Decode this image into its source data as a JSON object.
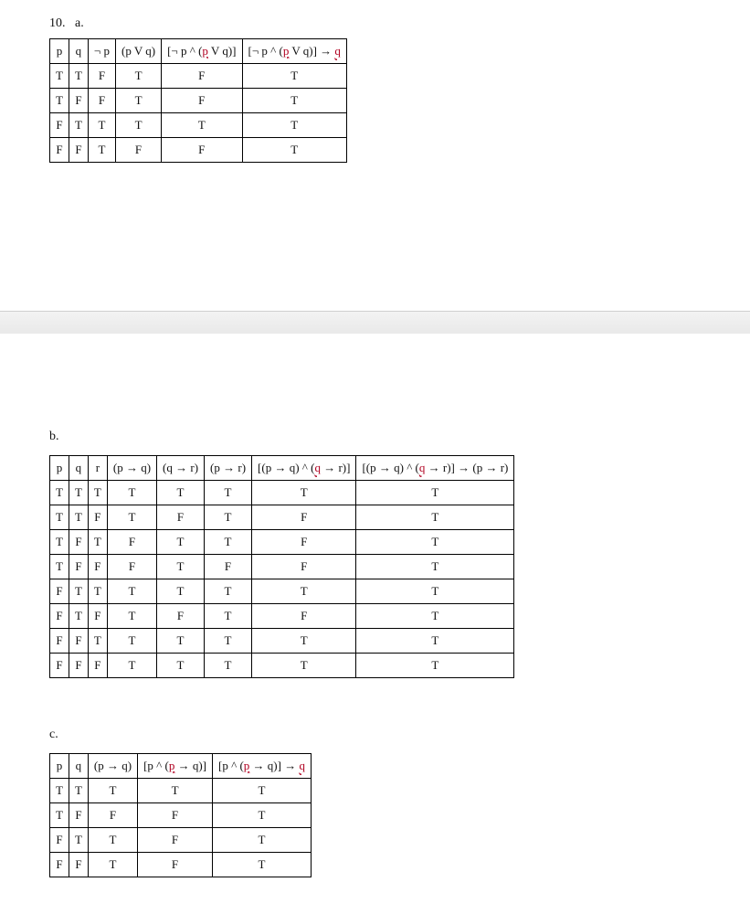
{
  "problem_number": "10.",
  "parts": {
    "a": {
      "label": "a.",
      "headers": [
        "p",
        "q",
        "¬ p",
        "(p V q)",
        "[¬ p ^ (p V q)]",
        "[¬ p ^ (p V q)] → q"
      ],
      "rows": [
        [
          "T",
          "T",
          "F",
          "T",
          "F",
          "T"
        ],
        [
          "T",
          "F",
          "F",
          "T",
          "F",
          "T"
        ],
        [
          "F",
          "T",
          "T",
          "T",
          "T",
          "T"
        ],
        [
          "F",
          "F",
          "T",
          "F",
          "F",
          "T"
        ]
      ]
    },
    "b": {
      "label": "b.",
      "headers": [
        "p",
        "q",
        "r",
        "(p → q)",
        "(q → r)",
        "(p → r)",
        "[(p → q) ^ (q → r)]",
        "[(p → q) ^ (q → r)] → (p → r)"
      ],
      "rows": [
        [
          "T",
          "T",
          "T",
          "T",
          "T",
          "T",
          "T",
          "T"
        ],
        [
          "T",
          "T",
          "F",
          "T",
          "F",
          "T",
          "F",
          "T"
        ],
        [
          "T",
          "F",
          "T",
          "F",
          "T",
          "T",
          "F",
          "T"
        ],
        [
          "T",
          "F",
          "F",
          "F",
          "T",
          "F",
          "F",
          "T"
        ],
        [
          "F",
          "T",
          "T",
          "T",
          "T",
          "T",
          "T",
          "T"
        ],
        [
          "F",
          "T",
          "F",
          "T",
          "F",
          "T",
          "F",
          "T"
        ],
        [
          "F",
          "F",
          "T",
          "T",
          "T",
          "T",
          "T",
          "T"
        ],
        [
          "F",
          "F",
          "F",
          "T",
          "T",
          "T",
          "T",
          "T"
        ]
      ]
    },
    "c": {
      "label": "c.",
      "headers": [
        "p",
        "q",
        "(p → q)",
        "[p ^ (p → q)]",
        "[p ^ (p → q)] → q"
      ],
      "rows": [
        [
          "T",
          "T",
          "T",
          "T",
          "T"
        ],
        [
          "T",
          "F",
          "F",
          "F",
          "T"
        ],
        [
          "F",
          "T",
          "T",
          "F",
          "T"
        ],
        [
          "F",
          "F",
          "T",
          "F",
          "T"
        ]
      ]
    }
  },
  "chart_data": [
    {
      "type": "table",
      "title": "10.a truth table",
      "columns": [
        "p",
        "q",
        "¬p",
        "(p ∨ q)",
        "¬p ∧ (p ∨ q)",
        "[¬p ∧ (p ∨ q)] → q"
      ],
      "rows": [
        [
          "T",
          "T",
          "F",
          "T",
          "F",
          "T"
        ],
        [
          "T",
          "F",
          "F",
          "T",
          "F",
          "T"
        ],
        [
          "F",
          "T",
          "T",
          "T",
          "T",
          "T"
        ],
        [
          "F",
          "F",
          "T",
          "F",
          "F",
          "T"
        ]
      ]
    },
    {
      "type": "table",
      "title": "10.b truth table",
      "columns": [
        "p",
        "q",
        "r",
        "(p→q)",
        "(q→r)",
        "(p→r)",
        "(p→q)∧(q→r)",
        "[(p→q)∧(q→r)]→(p→r)"
      ],
      "rows": [
        [
          "T",
          "T",
          "T",
          "T",
          "T",
          "T",
          "T",
          "T"
        ],
        [
          "T",
          "T",
          "F",
          "T",
          "F",
          "T",
          "F",
          "T"
        ],
        [
          "T",
          "F",
          "T",
          "F",
          "T",
          "T",
          "F",
          "T"
        ],
        [
          "T",
          "F",
          "F",
          "F",
          "T",
          "F",
          "F",
          "T"
        ],
        [
          "F",
          "T",
          "T",
          "T",
          "T",
          "T",
          "T",
          "T"
        ],
        [
          "F",
          "T",
          "F",
          "T",
          "F",
          "T",
          "F",
          "T"
        ],
        [
          "F",
          "F",
          "T",
          "T",
          "T",
          "T",
          "T",
          "T"
        ],
        [
          "F",
          "F",
          "F",
          "T",
          "T",
          "T",
          "T",
          "T"
        ]
      ]
    },
    {
      "type": "table",
      "title": "10.c truth table",
      "columns": [
        "p",
        "q",
        "(p→q)",
        "p∧(p→q)",
        "[p∧(p→q)]→q"
      ],
      "rows": [
        [
          "T",
          "T",
          "T",
          "T",
          "T"
        ],
        [
          "T",
          "F",
          "F",
          "F",
          "T"
        ],
        [
          "F",
          "T",
          "T",
          "F",
          "T"
        ],
        [
          "F",
          "F",
          "T",
          "F",
          "T"
        ]
      ]
    }
  ]
}
